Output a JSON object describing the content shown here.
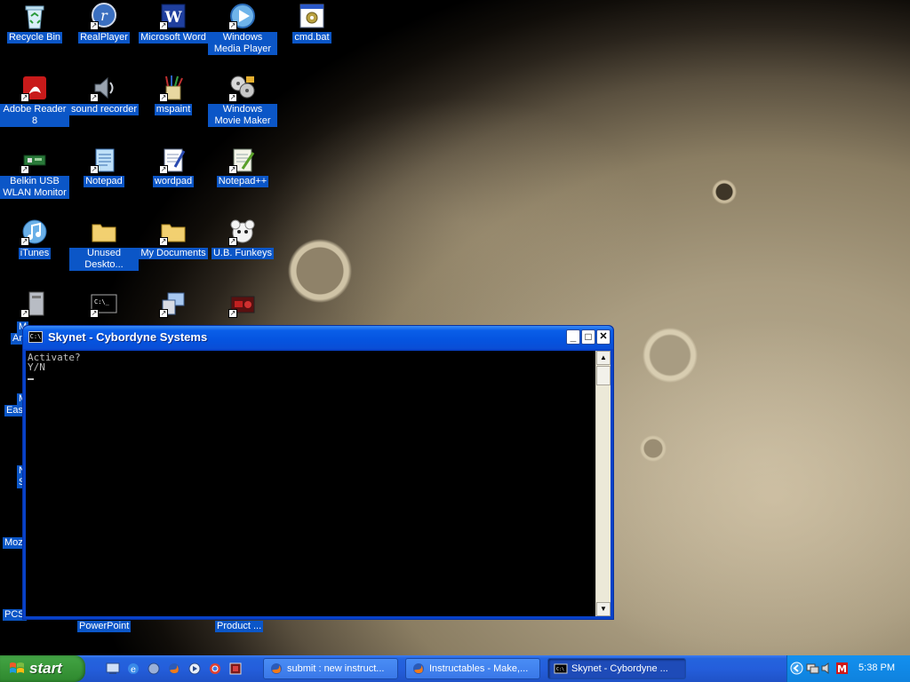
{
  "desktop": {
    "icons": [
      {
        "label": "Recycle Bin"
      },
      {
        "label": "RealPlayer"
      },
      {
        "label": "Microsoft Word"
      },
      {
        "label": "Windows Media Player"
      },
      {
        "label": "cmd.bat"
      },
      {
        "label": "Adobe Reader 8"
      },
      {
        "label": "sound recorder"
      },
      {
        "label": "mspaint"
      },
      {
        "label": "Windows Movie Maker"
      },
      {
        "label": "Belkin USB WLAN Monitor"
      },
      {
        "label": "Notepad"
      },
      {
        "label": "wordpad"
      },
      {
        "label": "Notepad++"
      },
      {
        "label": "iTunes"
      },
      {
        "label": "Unused Deskto..."
      },
      {
        "label": "My Documents"
      },
      {
        "label": "U.B. Funkeys"
      }
    ],
    "partial_labels": [
      "M",
      "An",
      "M",
      "Eas",
      "N",
      "S",
      "Moz",
      "PCS",
      "PowerPoint",
      "Product ..."
    ]
  },
  "window": {
    "title": "Skynet - Cybordyne Systems",
    "icon_text": "C:\\",
    "minimize": "_",
    "maximize": "□",
    "close": "✕",
    "console_lines": [
      "Activate?",
      "Y/N"
    ],
    "scroll_up": "▲",
    "scroll_down": "▼"
  },
  "taskbar": {
    "start_label": "start",
    "tasks": [
      {
        "label": "submit : new instruct..."
      },
      {
        "label": "Instructables - Make,..."
      },
      {
        "label": "Skynet - Cybordyne ..."
      }
    ],
    "clock": "5:38 PM"
  },
  "colors": {
    "selection_blue": "#0b56c7",
    "titlebar_blue": "#0554e0",
    "start_green": "#3b9a3b",
    "taskbar_blue": "#245edb"
  }
}
